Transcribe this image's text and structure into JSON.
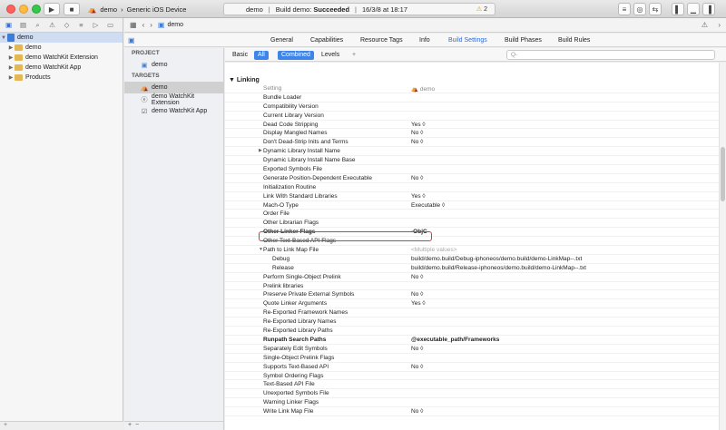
{
  "toolbar": {
    "scheme_name": "demo",
    "device": "Generic iOS Device",
    "activity_project": "demo",
    "activity_status_prefix": "Build demo:",
    "activity_status": "Succeeded",
    "activity_time": "16/3/8 at 18:17",
    "warnings": "2"
  },
  "navigator": {
    "items": [
      {
        "label": "demo"
      },
      {
        "label": "demo"
      },
      {
        "label": "demo WatchKit Extension"
      },
      {
        "label": "demo WatchKit App"
      },
      {
        "label": "Products"
      }
    ]
  },
  "jumpbar": {
    "file": "demo"
  },
  "tabs": [
    "General",
    "Capabilities",
    "Resource Tags",
    "Info",
    "Build Settings",
    "Build Phases",
    "Build Rules"
  ],
  "targets_panel": {
    "project_header": "PROJECT",
    "project_item": "demo",
    "targets_header": "TARGETS",
    "targets": [
      "demo",
      "demo WatchKit Extension",
      "demo WatchKit App"
    ]
  },
  "filter": {
    "basic": "Basic",
    "all": "All",
    "combined": "Combined",
    "levels": "Levels",
    "add": "+",
    "search_placeholder": "Q-"
  },
  "settings": {
    "section": "Linking",
    "column_setting": "Setting",
    "column_target": "demo",
    "rows": [
      {
        "k": "Bundle Loader",
        "v": ""
      },
      {
        "k": "Compatibility Version",
        "v": ""
      },
      {
        "k": "Current Library Version",
        "v": ""
      },
      {
        "k": "Dead Code Stripping",
        "v": "Yes ◊"
      },
      {
        "k": "Display Mangled Names",
        "v": "No ◊"
      },
      {
        "k": "Don't Dead-Strip Inits and Terms",
        "v": "No ◊"
      },
      {
        "k": "Dynamic Library Install Name",
        "v": "",
        "disclosure": "▶"
      },
      {
        "k": "Dynamic Library Install Name Base",
        "v": ""
      },
      {
        "k": "Exported Symbols File",
        "v": ""
      },
      {
        "k": "Generate Position-Dependent Executable",
        "v": "No ◊"
      },
      {
        "k": "Initialization Routine",
        "v": ""
      },
      {
        "k": "Link With Standard Libraries",
        "v": "Yes ◊"
      },
      {
        "k": "Mach-O Type",
        "v": "Executable ◊"
      },
      {
        "k": "Order File",
        "v": ""
      },
      {
        "k": "Other Librarian Flags",
        "v": ""
      },
      {
        "k": "Other Linker Flags",
        "v": "-ObjC",
        "bold": true
      },
      {
        "k": "Other Text-Based API Flags",
        "v": ""
      },
      {
        "k": "Path to Link Map File",
        "v": "<Multiple values>",
        "dim": true,
        "disclosure": "▼"
      },
      {
        "k": "Debug",
        "v": "build/demo.build/Debug-iphoneos/demo.build/demo-LinkMap--.txt",
        "indent": true
      },
      {
        "k": "Release",
        "v": "build/demo.build/Release-iphoneos/demo.build/demo-LinkMap--.txt",
        "indent": true
      },
      {
        "k": "Perform Single-Object Prelink",
        "v": "No ◊"
      },
      {
        "k": "Prelink libraries",
        "v": ""
      },
      {
        "k": "Preserve Private External Symbols",
        "v": "No ◊"
      },
      {
        "k": "Quote Linker Arguments",
        "v": "Yes ◊"
      },
      {
        "k": "Re-Exported Framework Names",
        "v": ""
      },
      {
        "k": "Re-Exported Library Names",
        "v": ""
      },
      {
        "k": "Re-Exported Library Paths",
        "v": ""
      },
      {
        "k": "Runpath Search Paths",
        "v": "@executable_path/Frameworks",
        "bold": true
      },
      {
        "k": "Separately Edit Symbols",
        "v": "No ◊"
      },
      {
        "k": "Single-Object Prelink Flags",
        "v": ""
      },
      {
        "k": "Supports Text-Based API",
        "v": "No ◊"
      },
      {
        "k": "Symbol Ordering Flags",
        "v": ""
      },
      {
        "k": "Text-Based API File",
        "v": ""
      },
      {
        "k": "Unexported Symbols File",
        "v": ""
      },
      {
        "k": "Warning Linker Flags",
        "v": ""
      },
      {
        "k": "Write Link Map File",
        "v": "No ◊"
      }
    ]
  }
}
